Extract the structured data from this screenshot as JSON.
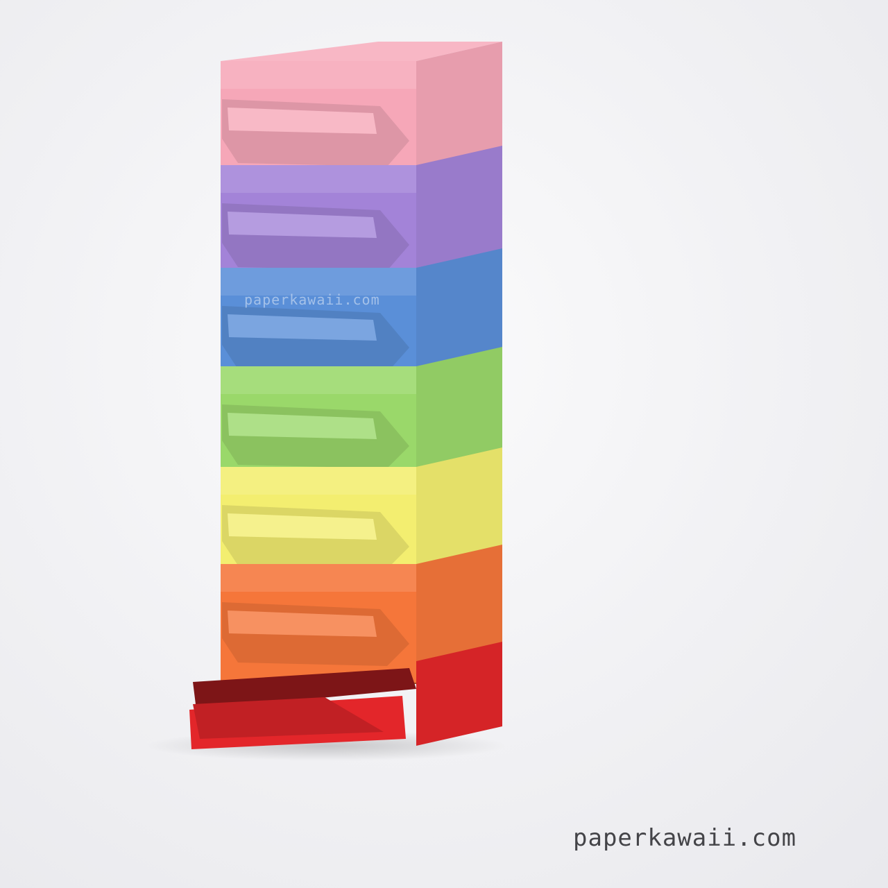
{
  "image": {
    "subject": "origami-drawer-tower",
    "background_color": "#f4f4f6",
    "drawers": [
      {
        "name": "pink",
        "color": "#f6a7b8",
        "state": "closed"
      },
      {
        "name": "purple",
        "color": "#a383d8",
        "state": "closed"
      },
      {
        "name": "blue",
        "color": "#5a8fd8",
        "state": "closed"
      },
      {
        "name": "green",
        "color": "#9ad86a",
        "state": "closed"
      },
      {
        "name": "yellow",
        "color": "#f3ee70",
        "state": "closed"
      },
      {
        "name": "orange",
        "color": "#f5763a",
        "state": "closed"
      },
      {
        "name": "red",
        "color": "#e3262a",
        "state": "open"
      }
    ]
  },
  "watermark": {
    "center_text": "paperkawaii.com",
    "corner_text": "paperkawaii.com"
  }
}
